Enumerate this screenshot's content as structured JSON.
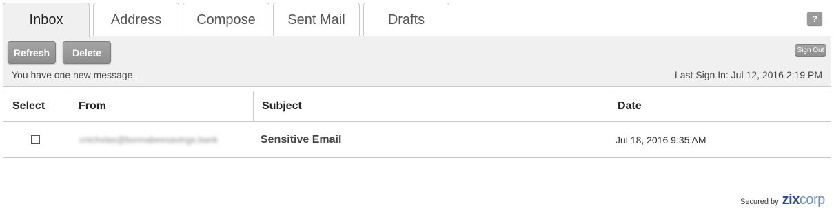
{
  "tabs": [
    {
      "label": "Inbox",
      "active": true
    },
    {
      "label": "Address",
      "active": false
    },
    {
      "label": "Compose",
      "active": false
    },
    {
      "label": "Sent Mail",
      "active": false
    },
    {
      "label": "Drafts",
      "active": false
    }
  ],
  "help": {
    "label": "?"
  },
  "toolbar": {
    "refresh_label": "Refresh",
    "delete_label": "Delete",
    "signout_label": "Sign Out",
    "status_message": "You have one new message.",
    "last_sign_in": "Last Sign In: Jul 12, 2016 2:19 PM"
  },
  "table": {
    "headers": {
      "select": "Select",
      "from": "From",
      "subject": "Subject",
      "date": "Date"
    },
    "rows": [
      {
        "checked": false,
        "from": "cnicholas@bonnabeesavings.bank",
        "subject": "Sensitive Email",
        "date": "Jul 18, 2016 9:35 AM"
      }
    ]
  },
  "footer": {
    "secured_by": "Secured by",
    "logo_bold": "zix",
    "logo_light": "corp"
  },
  "colors": {
    "button_gray": "#9a9a9a",
    "panel_bg": "#f0f0f0",
    "border": "#c8c8c8",
    "logo_blue": "#2b4f8c"
  }
}
